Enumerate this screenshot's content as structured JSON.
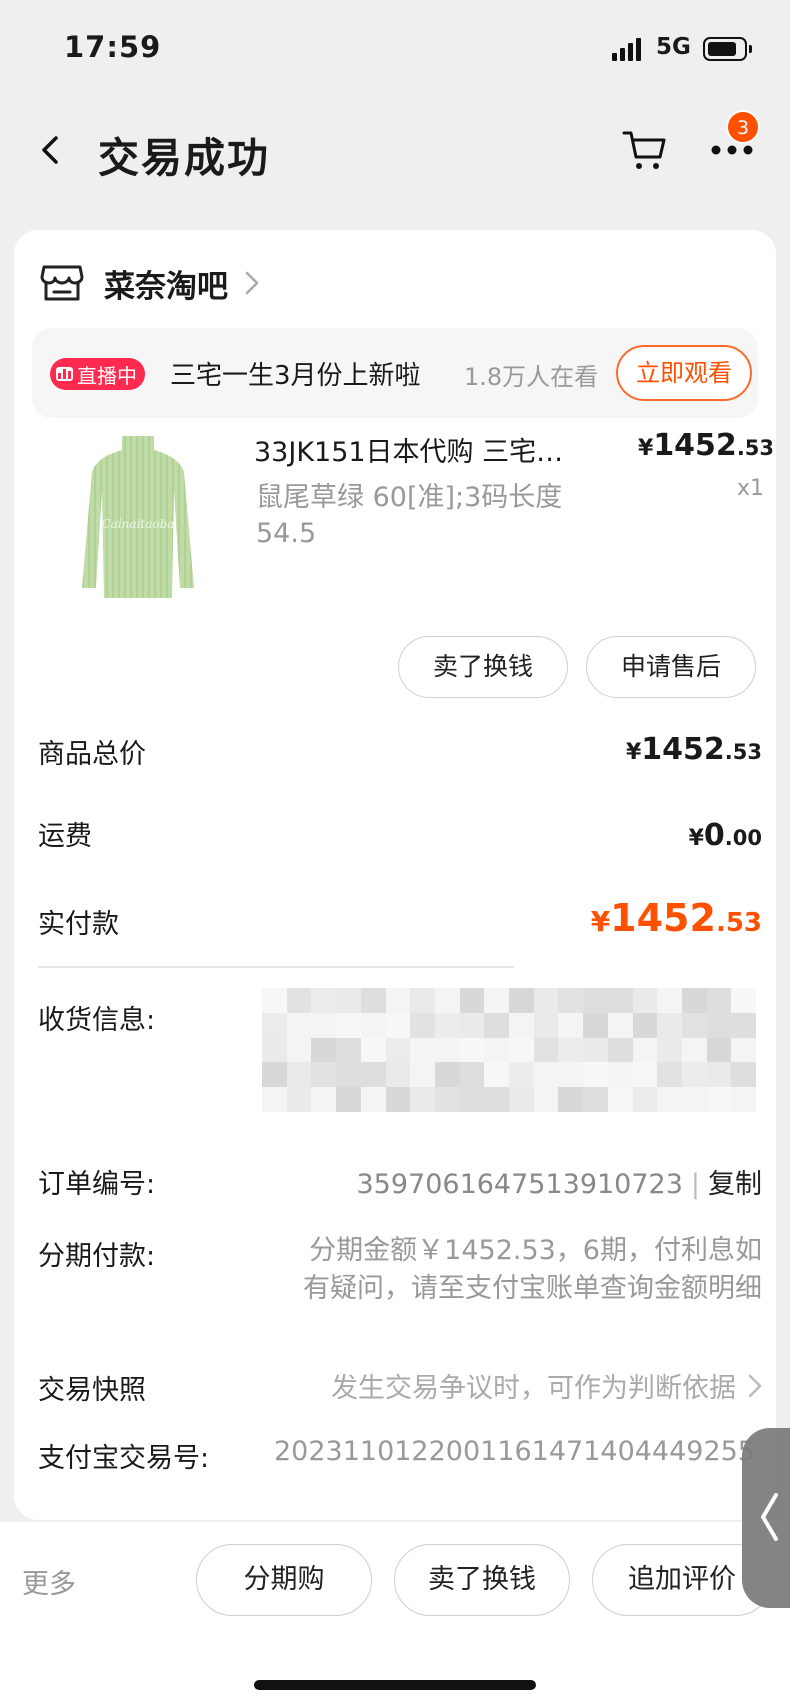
{
  "status_bar": {
    "time": "17:59",
    "network": "5G"
  },
  "nav": {
    "title": "交易成功",
    "badge_count": "3"
  },
  "shop": {
    "name": "菜奈淘吧"
  },
  "live": {
    "tag": "直播中",
    "text": "三宅一生3月份上新啦",
    "viewers": "1.8万人在看",
    "watch_label": "立即观看"
  },
  "product": {
    "title": "33JK151日本代购 三宅…",
    "sku": "鼠尾草绿 60[准];3码长度 54.5",
    "price": {
      "symbol": "¥",
      "int": "1452",
      "dec": ".53"
    },
    "qty": "x1",
    "accent_color": "#b9d9a1"
  },
  "product_actions": {
    "sell": "卖了换钱",
    "after_sale": "申请售后"
  },
  "summary": {
    "total_label": "商品总价",
    "total": {
      "symbol": "¥",
      "int": "1452",
      "dec": ".53"
    },
    "shipping_label": "运费",
    "shipping": {
      "symbol": "¥",
      "int": "0",
      "dec": ".00"
    },
    "paid_label": "实付款",
    "paid": {
      "symbol": "¥",
      "int": "1452",
      "dec": ".53"
    }
  },
  "info": {
    "receiver_label": "收货信息:",
    "order_label": "订单编号:",
    "order_no": "3597061647513910723",
    "separator": "|",
    "copy_label": "复制",
    "installment_label": "分期付款:",
    "installment_text": "分期金额￥1452.53，6期，付利息如有疑问，请至支付宝账单查询金额明细",
    "snapshot_label": "交易快照",
    "snapshot_text": "发生交易争议时，可作为判断依据",
    "alipay_label": "支付宝交易号:",
    "alipay_no": "2023110122001161471404449255"
  },
  "bottom_bar": {
    "more": "更多",
    "installment": "分期购",
    "sell": "卖了换钱",
    "review": "追加评价"
  },
  "colors": {
    "accent": "#ff5000",
    "live": "#ff2a4e"
  }
}
